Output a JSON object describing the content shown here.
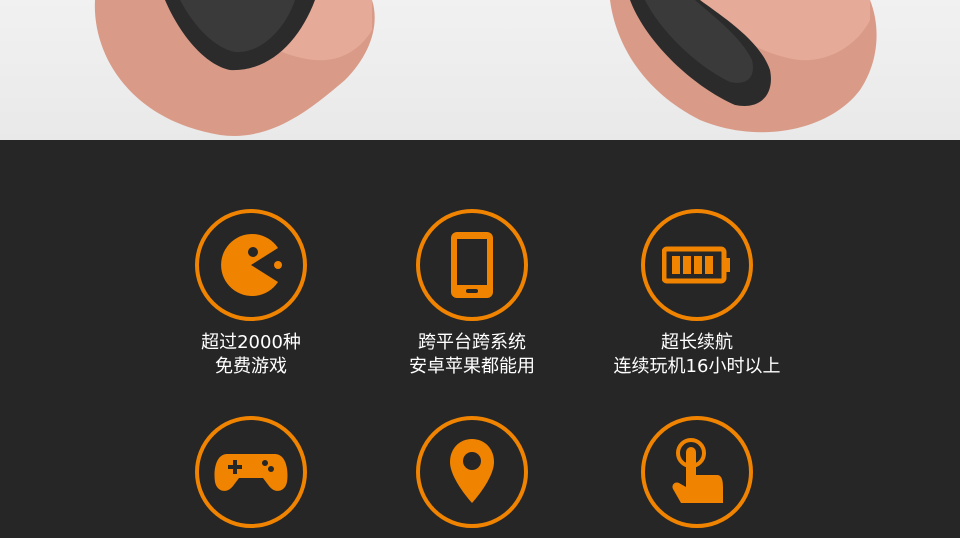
{
  "colors": {
    "accent": "#f08300",
    "panel_bg": "#262626",
    "text": "#ffffff"
  },
  "features": [
    {
      "icon": "pacman-icon",
      "line1": "超过2000种",
      "line2": "免费游戏"
    },
    {
      "icon": "smartphone-icon",
      "line1": "跨平台跨系统",
      "line2": "安卓苹果都能用"
    },
    {
      "icon": "battery-icon",
      "line1": "超长续航",
      "line2": "连续玩机16小时以上"
    },
    {
      "icon": "gamepad-icon",
      "line1": "",
      "line2": ""
    },
    {
      "icon": "location-pin-icon",
      "line1": "",
      "line2": ""
    },
    {
      "icon": "touch-hand-icon",
      "line1": "",
      "line2": ""
    }
  ]
}
